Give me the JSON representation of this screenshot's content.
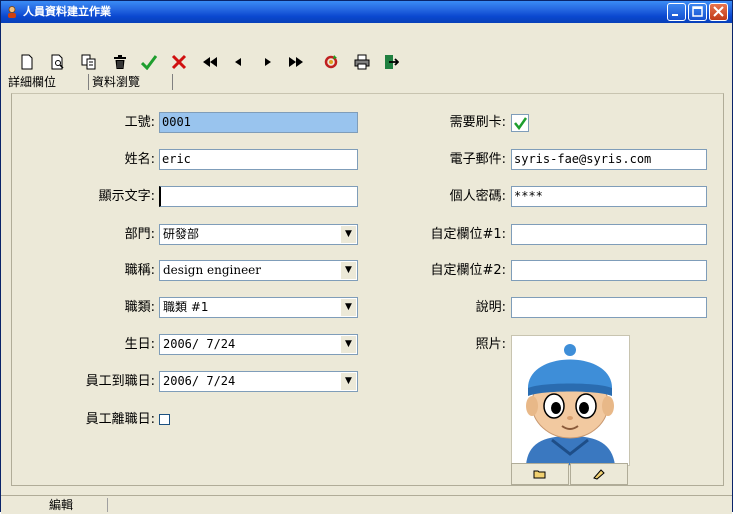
{
  "window": {
    "title": "人員資料建立作業"
  },
  "toolbar": {
    "icons": [
      "new-icon",
      "preview-icon",
      "copy-icon",
      "delete-icon",
      "confirm-icon",
      "cancel-icon",
      "first-icon",
      "prev-icon",
      "next-icon",
      "last-icon",
      "refresh-icon",
      "print-icon",
      "exit-icon"
    ]
  },
  "tabs": [
    {
      "label": "詳細欄位"
    },
    {
      "label": "資料瀏覽"
    }
  ],
  "form": {
    "emp_no": {
      "label": "工號:",
      "value": "0001"
    },
    "name": {
      "label": "姓名:",
      "value": "eric"
    },
    "display": {
      "label": "顯示文字:",
      "value": ""
    },
    "dept": {
      "label": "部門:",
      "value": "研發部"
    },
    "title": {
      "label": "職稱:",
      "value": "design engineer"
    },
    "category": {
      "label": "職類:",
      "value": "職類 #1"
    },
    "birthday": {
      "label": "生日:",
      "value": "2006/ 7/24"
    },
    "join_date": {
      "label": "員工到職日:",
      "value": "2006/ 7/24"
    },
    "leave_date": {
      "label": "員工離職日:"
    },
    "need_card": {
      "label": "需要刷卡:"
    },
    "email": {
      "label": "電子郵件:",
      "value": "syris-fae@syris.com"
    },
    "password": {
      "label": "個人密碼:",
      "value": "****"
    },
    "custom1": {
      "label": "自定欄位#1:",
      "value": ""
    },
    "custom2": {
      "label": "自定欄位#2:",
      "value": ""
    },
    "note": {
      "label": "說明:",
      "value": ""
    },
    "photo": {
      "label": "照片:"
    }
  },
  "status": {
    "text": "編輯"
  },
  "colors": {
    "titlebar": "#0A48D0",
    "selected_input": "#99C4EE",
    "check": "#1E9E2E",
    "cancel": "#D01010"
  }
}
